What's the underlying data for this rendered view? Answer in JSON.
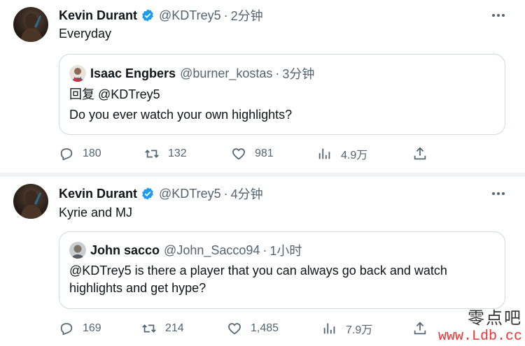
{
  "tweets": [
    {
      "author_name": "Kevin Durant",
      "handle": "@KDTrey5",
      "separator": "·",
      "time": "2分钟",
      "text": "Everyday",
      "quote": {
        "author_name": "Isaac Engbers",
        "handle": "@burner_kostas",
        "separator": "·",
        "time": "3分钟",
        "lines": [
          "回复 @KDTrey5",
          "Do you ever watch your own highlights?"
        ]
      },
      "actions": {
        "replies": "180",
        "retweets": "132",
        "likes": "981",
        "views": "4.9万"
      }
    },
    {
      "author_name": "Kevin Durant",
      "handle": "@KDTrey5",
      "separator": "·",
      "time": "4分钟",
      "text": "Kyrie and MJ",
      "quote": {
        "author_name": "John sacco",
        "handle": "@John_Sacco94",
        "separator": "·",
        "time": "1小时",
        "lines": [
          "@KDTrey5 is there a player that you can always go back and watch",
          "highlights and get hype?"
        ]
      },
      "actions": {
        "replies": "169",
        "retweets": "214",
        "likes": "1,485",
        "views": "7.9万"
      }
    }
  ],
  "watermark": {
    "top": "零点吧",
    "url": "www.Ldb.cc"
  },
  "colors": {
    "verified": "#1d9bf0",
    "secondary_text": "#536471",
    "border": "#cfd9de"
  }
}
